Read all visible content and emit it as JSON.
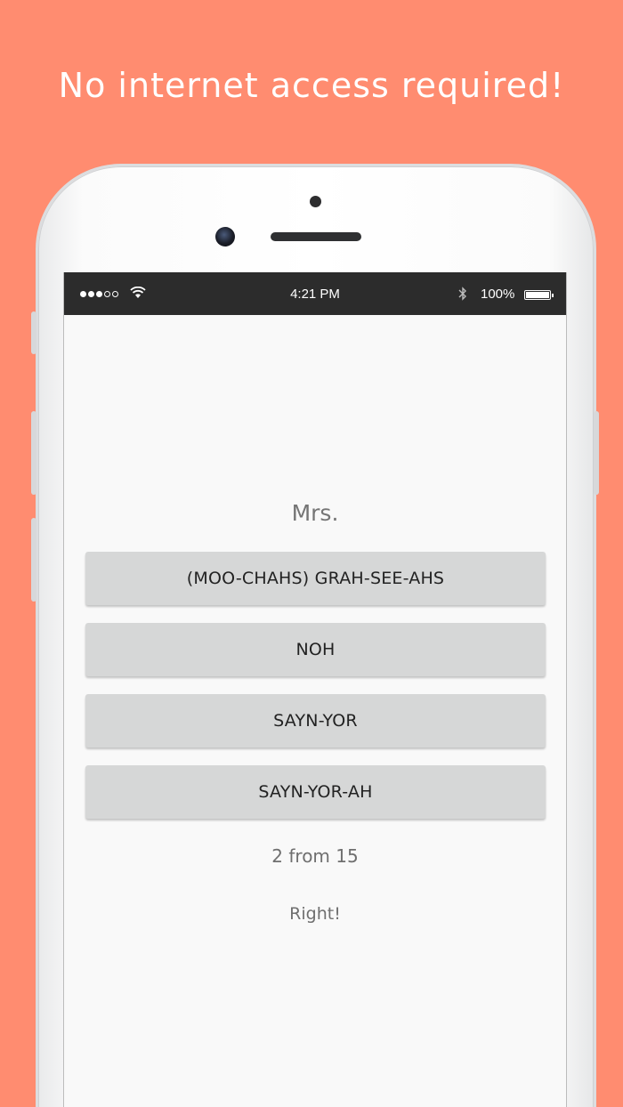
{
  "headline": "No internet access required!",
  "statusbar": {
    "time": "4:21 PM",
    "battery": "100%",
    "signal_icon": "signal-dots-icon",
    "wifi_icon": "wifi-icon",
    "bluetooth_icon": "bluetooth-icon",
    "battery_icon": "battery-icon"
  },
  "quiz": {
    "question": "Mrs.",
    "answers": [
      "(MOO-CHAHS) GRAH-SEE-AHS",
      "NOH",
      "SAYN-YOR",
      "SAYN-YOR-AH"
    ],
    "progress": "2 from 15",
    "feedback": "Right!"
  },
  "colors": {
    "background": "#ff8c70",
    "button": "#d6d7d7",
    "statusbar": "#2c2c2c"
  }
}
